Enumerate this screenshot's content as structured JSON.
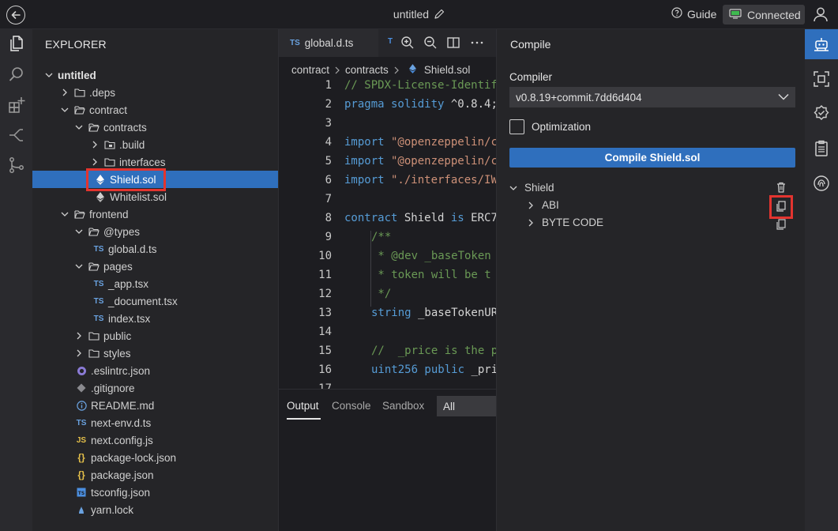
{
  "topbar": {
    "title": "untitled",
    "guide_label": "Guide",
    "connection_status": "Connected"
  },
  "explorer": {
    "title": "EXPLORER",
    "items": [
      {
        "label": "untitled",
        "type": "folder-root",
        "open": true
      },
      {
        "label": ".deps",
        "type": "folder",
        "open": false
      },
      {
        "label": "contract",
        "type": "folder",
        "open": true
      },
      {
        "label": "contracts",
        "type": "folder",
        "open": true
      },
      {
        "label": ".build",
        "type": "folder",
        "open": false
      },
      {
        "label": "interfaces",
        "type": "folder",
        "open": false
      },
      {
        "label": "Shield.sol",
        "type": "solidity",
        "selected": true
      },
      {
        "label": "Whitelist.sol",
        "type": "solidity"
      },
      {
        "label": "frontend",
        "type": "folder",
        "open": true
      },
      {
        "label": "@types",
        "type": "folder",
        "open": true
      },
      {
        "label": "global.d.ts",
        "type": "ts"
      },
      {
        "label": "pages",
        "type": "folder",
        "open": true
      },
      {
        "label": "_app.tsx",
        "type": "ts"
      },
      {
        "label": "_document.tsx",
        "type": "ts"
      },
      {
        "label": "index.tsx",
        "type": "ts"
      },
      {
        "label": "public",
        "type": "folder",
        "open": false
      },
      {
        "label": "styles",
        "type": "folder",
        "open": false
      },
      {
        "label": ".eslintrc.json",
        "type": "eslint"
      },
      {
        "label": ".gitignore",
        "type": "git"
      },
      {
        "label": "README.md",
        "type": "info"
      },
      {
        "label": "next-env.d.ts",
        "type": "ts"
      },
      {
        "label": "next.config.js",
        "type": "js"
      },
      {
        "label": "package-lock.json",
        "type": "json"
      },
      {
        "label": "package.json",
        "type": "json"
      },
      {
        "label": "tsconfig.json",
        "type": "tsconfig"
      },
      {
        "label": "yarn.lock",
        "type": "yarn"
      }
    ]
  },
  "editor": {
    "tabs": [
      {
        "icon_text": "TS",
        "label": "global.d.ts"
      },
      {
        "icon_text": "T",
        "label": ""
      }
    ],
    "breadcrumb": [
      "contract",
      "contracts",
      "Shield.sol"
    ],
    "line_numbers": [
      "1",
      "2",
      "3",
      "4",
      "5",
      "6",
      "7",
      "8",
      "9",
      "10",
      "11",
      "12",
      "13",
      "14",
      "15",
      "16",
      "17"
    ],
    "code": {
      "l1": "// SPDX-License-Identif",
      "l2_kw": "pragma solidity",
      "l2_rest": " ^0.8.4;",
      "l4_kw": "import",
      "l4_str": " \"@openzeppelin/c",
      "l5_kw": "import",
      "l5_str": " \"@openzeppelin/c",
      "l6_kw": "import",
      "l6_str": " \"./interfaces/IW",
      "l8_kw": "contract",
      "l8_name": " Shield",
      "l8_is": " is",
      "l8_base": " ERC7",
      "l9": "/**",
      "l10": " * @dev _baseToken",
      "l11": " * token will be t",
      "l12": " */",
      "l13_kw": "string",
      "l13_rest": " _baseTokenUR",
      "l15": "//  _price is the p",
      "l16_kw": "uint256 public",
      "l16_rest": " _pri"
    }
  },
  "output": {
    "tabs": [
      "Output",
      "Console",
      "Sandbox"
    ],
    "filter": "All"
  },
  "compile": {
    "title": "Compile",
    "compiler_label": "Compiler",
    "compiler_version": "v0.8.19+commit.7dd6d404",
    "optimization_label": "Optimization",
    "compile_button": "Compile Shield.sol",
    "contract_name": "Shield",
    "abi_label": "ABI",
    "bytecode_label": "BYTE CODE"
  },
  "colors": {
    "accent": "#2f6fbd",
    "highlight_box": "#e3342f"
  }
}
